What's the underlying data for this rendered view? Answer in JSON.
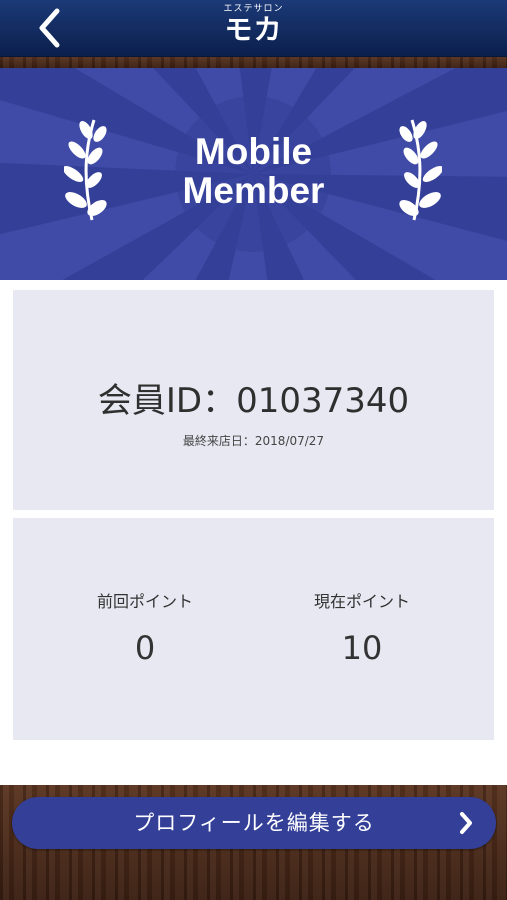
{
  "header": {
    "back_icon": "chevron-left-icon",
    "logo_subtitle": "エステサロン",
    "logo_title": "モカ"
  },
  "banner": {
    "title_line1": "Mobile",
    "title_line2": "Member",
    "ornament_icon": "laurel-icon"
  },
  "member": {
    "id_text": "会員ID：01037340",
    "last_visit": "最終来店日：2018/07/27"
  },
  "points": {
    "previous_label": "前回ポイント",
    "previous_value": "0",
    "current_label": "現在ポイント",
    "current_value": "10"
  },
  "actions": {
    "edit_profile_label": "プロフィールを編集する",
    "arrow_icon": "chevron-right-icon"
  },
  "colors": {
    "header": "#0b1f4c",
    "accent": "#343f98",
    "card": "#e8e8f3"
  }
}
